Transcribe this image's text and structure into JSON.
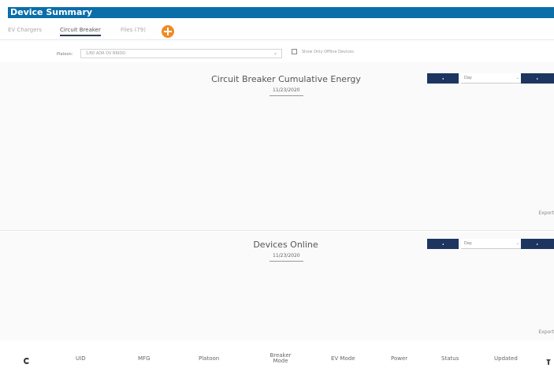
{
  "title": "Device Summary",
  "tabs": [
    {
      "label": "EV Chargers"
    },
    {
      "label": "Circuit Breaker"
    },
    {
      "label": "Files (79)"
    }
  ],
  "filters": {
    "platoon_label": "Platoon:",
    "platoon_value": "1/60 ADR OV BRIDD",
    "offline_label": "Show Only Offline Devices",
    "offline_checked": false
  },
  "chart1": {
    "title": "Circuit Breaker Cumulative Energy",
    "date": "11/23/2020",
    "period": "Day",
    "prev_label": "◂",
    "next_label": "▸",
    "export_label": "Export"
  },
  "chart2": {
    "title": "Devices Online",
    "date": "11/23/2020",
    "period": "Day",
    "prev_label": "◂",
    "next_label": "▸",
    "export_label": "Export"
  },
  "table": {
    "columns": [
      "UID",
      "MFG",
      "Platoon",
      "Breaker Mode",
      "EV Mode",
      "Power",
      "Status",
      "Updated"
    ]
  },
  "colors": {
    "header": "#0a6ea8",
    "nav_button": "#1e3560",
    "add_button": "#f08a24"
  },
  "icons": {
    "add": "plus-circle-icon",
    "refresh": "refresh-icon",
    "filter": "filter-icon",
    "dropdown": "chevron-down-icon"
  }
}
